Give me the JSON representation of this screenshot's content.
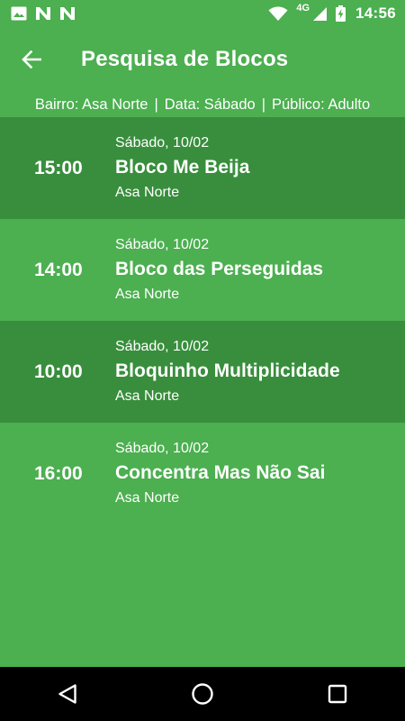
{
  "status_bar": {
    "left_icons": [
      "image-icon",
      "n-notification-icon",
      "n-notification-icon"
    ],
    "network_type": "4G",
    "time": "14:56",
    "right_icons": [
      "wifi-icon",
      "cell-signal-icon",
      "battery-charging-icon"
    ]
  },
  "app_bar": {
    "back_icon": "arrow-back-icon",
    "title": "Pesquisa de Blocos"
  },
  "filters": {
    "bairro": "Bairro: Asa Norte",
    "data": "Data: Sábado",
    "publico": "Público: Adulto",
    "separator": "|"
  },
  "results": [
    {
      "time": "15:00",
      "date": "Sábado, 10/02",
      "name": "Bloco Me Beija",
      "neighborhood": "Asa Norte"
    },
    {
      "time": "14:00",
      "date": "Sábado, 10/02",
      "name": "Bloco das Perseguidas",
      "neighborhood": "Asa Norte"
    },
    {
      "time": "10:00",
      "date": "Sábado, 10/02",
      "name": "Bloquinho Multiplicidade",
      "neighborhood": "Asa Norte"
    },
    {
      "time": "16:00",
      "date": "Sábado, 10/02",
      "name": "Concentra Mas Não Sai",
      "neighborhood": "Asa Norte"
    }
  ],
  "nav_bar": {
    "icons": [
      "back-triangle-icon",
      "home-circle-icon",
      "recents-square-icon"
    ]
  },
  "colors": {
    "primary": "#4caf50",
    "row_alt": "#388e3c",
    "text": "#ffffff",
    "nav_bar": "#000000"
  }
}
